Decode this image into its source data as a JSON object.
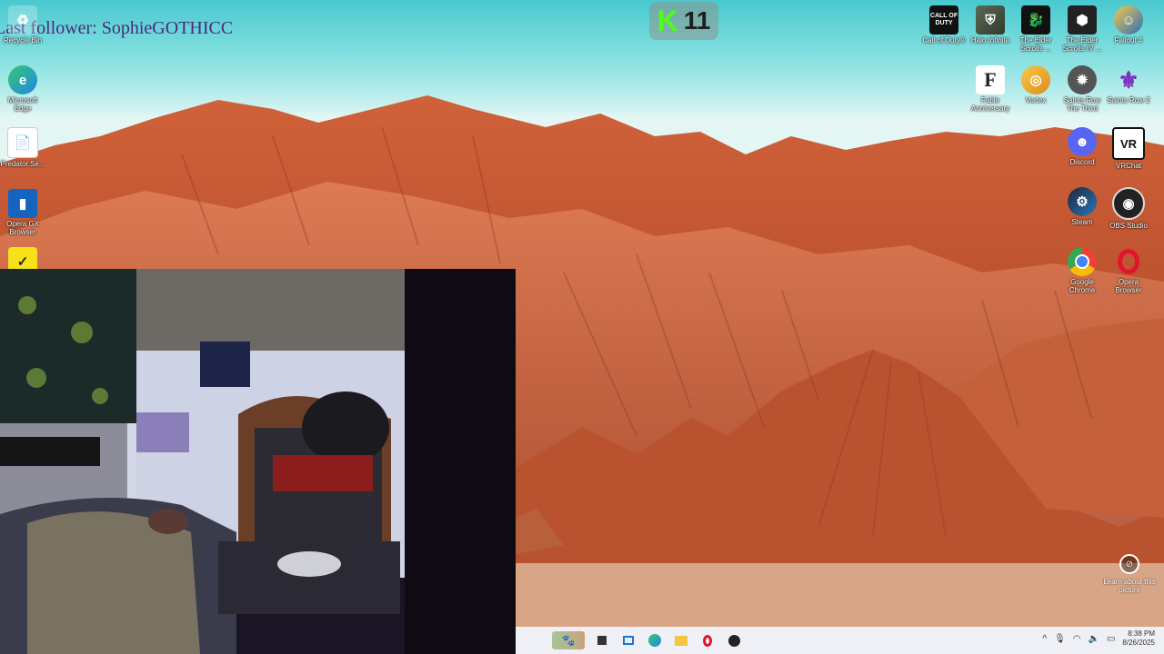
{
  "stream_overlay": {
    "last_follower": "Last follower: SophieGOTHICC",
    "kick_logo": "K",
    "kick_count": "11"
  },
  "desktop_icons_left": [
    {
      "label": "Recycle Bin",
      "icon": "recycle-bin-icon"
    },
    {
      "label": "Microsoft Edge",
      "icon": "edge-icon"
    },
    {
      "label": "Predator.Se...",
      "icon": "file-icon"
    },
    {
      "label": "Opera GX Browser",
      "icon": "opera-gx-icon"
    },
    {
      "label": "",
      "icon": "checkmark-app-icon"
    }
  ],
  "desktop_icons_right": [
    {
      "label": "Call of Duty®",
      "icon": "call-of-duty-icon",
      "badge": "CALL OF DUTY"
    },
    {
      "label": "Halo Infinite",
      "icon": "halo-infinite-icon"
    },
    {
      "label": "The Elder Scrolls ...",
      "icon": "elder-scrolls-icon"
    },
    {
      "label": "The Elder Scrolls IV ...",
      "icon": "oblivion-icon"
    },
    {
      "label": "Fallout 4",
      "icon": "fallout-icon"
    },
    {
      "label": "Fable Anniversary",
      "icon": "fable-icon",
      "badge": "F"
    },
    {
      "label": "Vortex",
      "icon": "vortex-icon"
    },
    {
      "label": "Saints Row The Third",
      "icon": "saints-row-3-icon"
    },
    {
      "label": "Saints Row 2",
      "icon": "saints-row-2-icon"
    },
    {
      "label": "Discord",
      "icon": "discord-icon"
    },
    {
      "label": "VRChat",
      "icon": "vrchat-icon",
      "badge": "VR"
    },
    {
      "label": "Steam",
      "icon": "steam-icon"
    },
    {
      "label": "OBS Studio",
      "icon": "obs-icon"
    },
    {
      "label": "Google Chrome",
      "icon": "chrome-icon"
    },
    {
      "label": "Opera Browser",
      "icon": "opera-icon"
    }
  ],
  "spotlight": {
    "label": "Learn about this picture",
    "icon": "camera-info-icon"
  },
  "taskbar": {
    "icons": [
      "widgets-icon",
      "task-view-icon",
      "store-icon",
      "edge-icon",
      "file-explorer-icon",
      "opera-icon",
      "obs-icon"
    ],
    "tray": {
      "chevron": "^",
      "time": "8:38 PM",
      "date": "8/26/2025"
    }
  },
  "colors": {
    "sky": "#8ee3e2",
    "rock": "#c65a33",
    "sand": "#d89f83",
    "taskbar": "#eef0f6",
    "follower_text": "#4a2a7a",
    "kick_green": "#53fc18"
  }
}
